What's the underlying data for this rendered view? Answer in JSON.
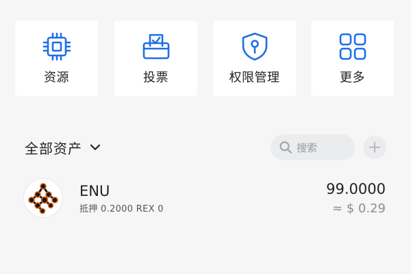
{
  "quick_actions": [
    {
      "label": "资源",
      "icon": "chip-icon"
    },
    {
      "label": "投票",
      "icon": "ballot-box-icon"
    },
    {
      "label": "权限管理",
      "icon": "shield-key-icon"
    },
    {
      "label": "更多",
      "icon": "grid-icon"
    }
  ],
  "assets": {
    "title": "全部资产",
    "search_placeholder": "搜索"
  },
  "tokens": [
    {
      "symbol": "ENU",
      "sub": "抵押 0.2000 REX 0",
      "balance": "99.0000",
      "fiat": "≈ $ 0.29"
    }
  ],
  "colors": {
    "accent": "#2f6fe0",
    "icon_blue": "#1f6fe5",
    "background": "#f6f6f7",
    "card": "#ffffff",
    "muted_text": "#8d8d92",
    "logo_dark": "#1a1a1a",
    "logo_orange": "#e8631b"
  }
}
